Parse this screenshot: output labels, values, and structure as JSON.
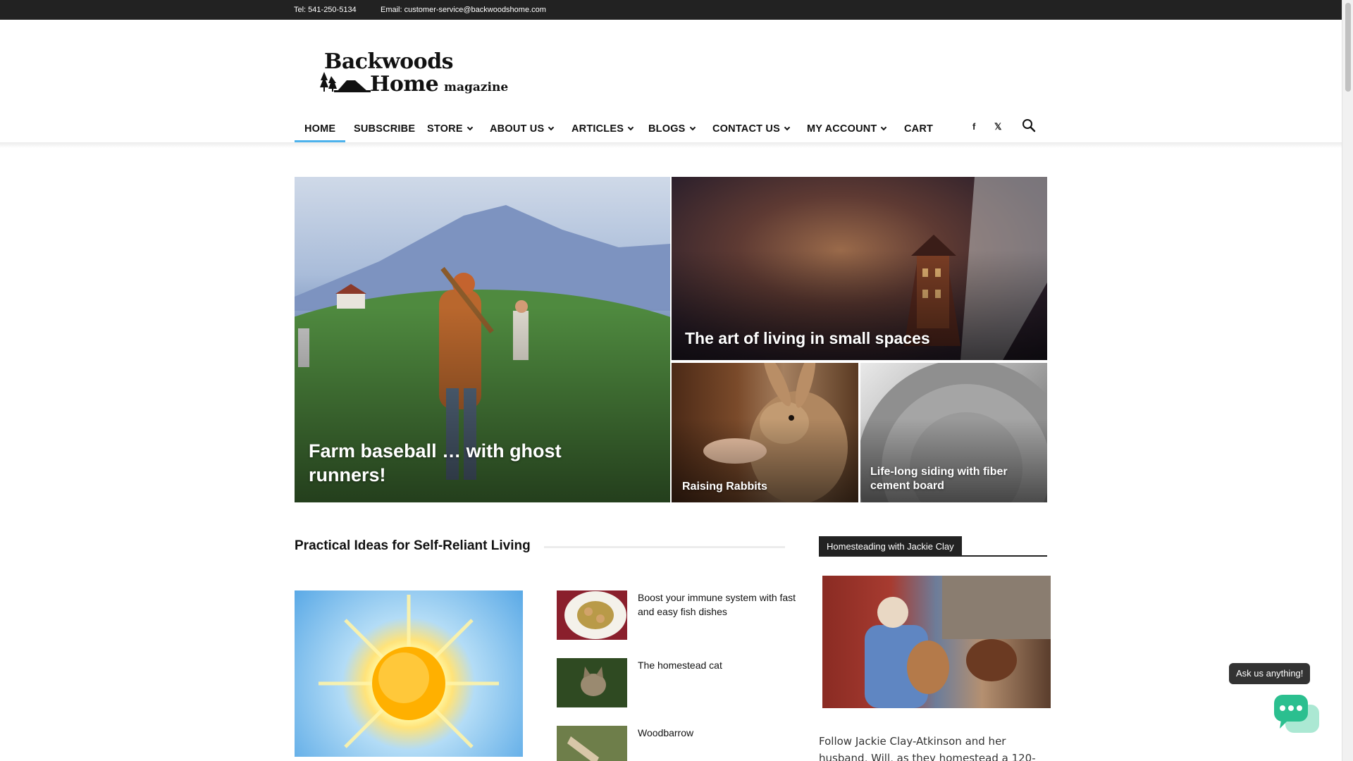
{
  "topbar": {
    "tel": "Tel: 541-250-5134",
    "email": "Email: customer-service@backwoodshome.com"
  },
  "logo": {
    "line1": "Backwoods",
    "line2": "Home",
    "line3": "magazine"
  },
  "nav": {
    "items": [
      {
        "label": "HOME",
        "dropdown": false,
        "active": true
      },
      {
        "label": "SUBSCRIBE",
        "dropdown": false
      },
      {
        "label": "STORE",
        "dropdown": true
      },
      {
        "label": "ABOUT US",
        "dropdown": true
      },
      {
        "label": "ARTICLES",
        "dropdown": true
      },
      {
        "label": "BLOGS",
        "dropdown": true
      },
      {
        "label": "CONTACT US",
        "dropdown": true
      },
      {
        "label": "MY ACCOUNT",
        "dropdown": true
      },
      {
        "label": "CART",
        "dropdown": false
      }
    ],
    "social": {
      "facebook": "f",
      "x": "𝕏"
    },
    "accent_color": "#4db2ec"
  },
  "hero": {
    "main": "Farm baseball … with ghost runners!",
    "top_right": "The art of living in small spaces",
    "bottom_left": "Raising Rabbits",
    "bottom_right": "Life-long siding with fiber cement board"
  },
  "section": {
    "title": "Practical Ideas for Self-Reliant Living",
    "items": [
      {
        "title": "Boost your immune system with fast and easy fish dishes",
        "icon": "fish-dish-thumbnail"
      },
      {
        "title": "The homestead cat",
        "icon": "cat-thumbnail"
      },
      {
        "title": "Woodbarrow",
        "icon": "woodbarrow-thumbnail"
      }
    ]
  },
  "sidebar": {
    "heading": "Homesteading with Jackie Clay",
    "text": "Follow Jackie Clay-Atkinson and her husband, Will, as they homestead a 120-"
  },
  "chat": {
    "bubble": "Ask us anything!"
  }
}
